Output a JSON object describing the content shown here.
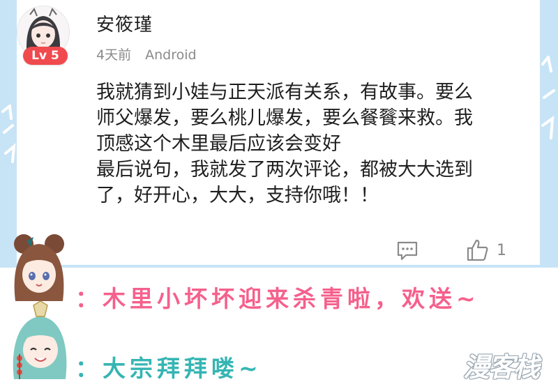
{
  "comment": {
    "username": "安筱瑾",
    "level_badge": "Lv 5",
    "time_ago": "4天前",
    "platform": "Android",
    "text": "我就猜到小娃与正天派有关系，有故事。要么\n师父爆发，要么桃儿爆发，要么餐餮来救。我\n顶感这个木里最后应该会变好\n最后说句，我就发了两次评论，都被大大选到\n了，好开心，大大，支持你哦！！",
    "like_count": "1"
  },
  "captions": {
    "pink": "：木里小坏坏迎来杀青啦，欢送~",
    "teal": "：大宗拜拜喽~"
  },
  "watermark": "漫客栈",
  "colors": {
    "background": "#c7e4f6",
    "pink_caption": "#f5608c",
    "teal_caption": "#35b5b3",
    "level_badge": "#f04a4e"
  },
  "icons": {
    "reply": "comment-bubble-icon",
    "like": "thumbs-up-icon"
  }
}
